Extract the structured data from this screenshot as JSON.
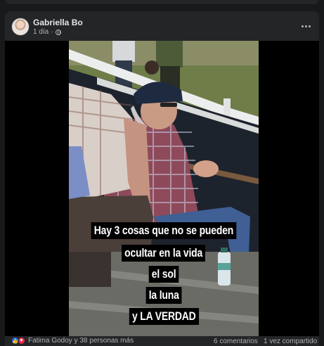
{
  "post": {
    "author": "Gabriella Bo",
    "time": "1 día",
    "privacy_icon": "globe-icon",
    "more_icon": "more-horizontal-icon"
  },
  "image": {
    "caption_lines": [
      "Hay 3 cosas que no se pueden",
      "ocultar en la vida",
      "el sol",
      "la luna",
      "y LA VERDAD"
    ]
  },
  "footer": {
    "reactions_text": "Fatima Godoy y 38 personas más",
    "comments": "6 comentarios",
    "shares": "1 vez compartido",
    "reaction_icons": [
      "like-icon",
      "love-icon"
    ]
  },
  "colors": {
    "background": "#18191a",
    "card": "#242526",
    "text_primary": "#e4e6eb",
    "text_secondary": "#b0b3b8",
    "like_blue": "#2078f4",
    "love_red": "#f0284a"
  }
}
